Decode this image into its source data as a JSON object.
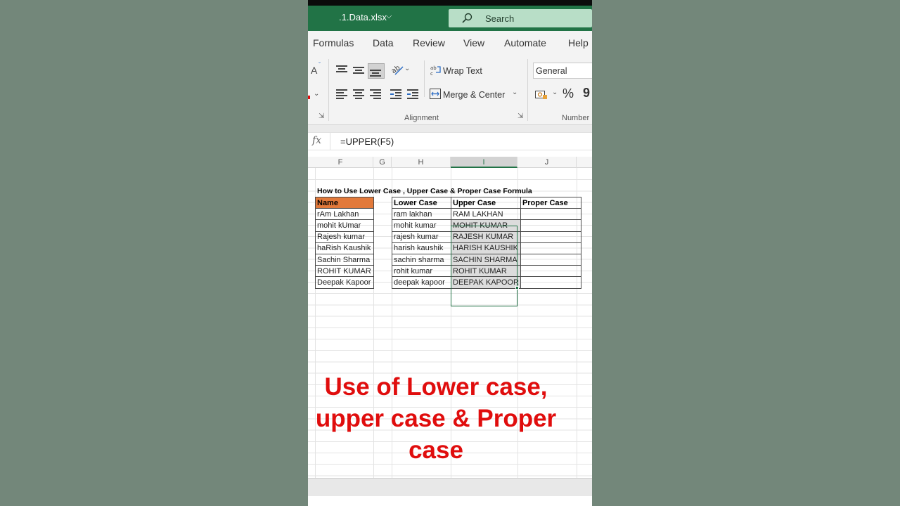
{
  "app": {
    "file_name": ".1.Data.xlsx",
    "search_placeholder": "Search"
  },
  "tabs": [
    "Formulas",
    "Data",
    "Review",
    "View",
    "Automate",
    "Help"
  ],
  "ribbon": {
    "font_grow_glyph": "A",
    "wrap_text": "Wrap Text",
    "merge_center": "Merge & Center",
    "alignment_group": "Alignment",
    "number_format": "General",
    "percent": "%",
    "comma": "9",
    "number_group": "Number"
  },
  "formula_bar": {
    "fx": "fx",
    "formula": "=UPPER(F5)"
  },
  "columns": [
    "F",
    "G",
    "H",
    "I",
    "J"
  ],
  "active_column": "I",
  "sheet": {
    "title": "How to Use Lower Case , Upper Case & Proper Case Formula",
    "name_table": {
      "header": "Name",
      "rows": [
        "rAm Lakhan",
        "mohit kUmar",
        "Rajesh kumar",
        "haRish Kaushik",
        "Sachin Sharma",
        "ROHIT KUMAR",
        "Deepak Kapoor"
      ]
    },
    "case_table": {
      "headers": [
        "Lower Case",
        "Upper Case",
        "Proper Case"
      ],
      "rows": [
        [
          "ram lakhan",
          "RAM LAKHAN",
          ""
        ],
        [
          "mohit kumar",
          "MOHIT KUMAR",
          ""
        ],
        [
          "rajesh kumar",
          "RAJESH KUMAR",
          ""
        ],
        [
          "harish kaushik",
          "HARISH KAUSHIK",
          ""
        ],
        [
          "sachin sharma",
          "SACHIN SHARMA",
          ""
        ],
        [
          "rohit kumar",
          "ROHIT KUMAR",
          ""
        ],
        [
          "deepak kapoor",
          "DEEPAK KAPOOR",
          ""
        ]
      ]
    }
  },
  "caption": {
    "line1": "Use of Lower case,",
    "line2": "upper case & Proper",
    "line3": "case"
  },
  "colors": {
    "excel_green": "#217346",
    "name_header_fill": "#e2793a",
    "caption_red": "#e00d0d",
    "background": "#73877a"
  }
}
